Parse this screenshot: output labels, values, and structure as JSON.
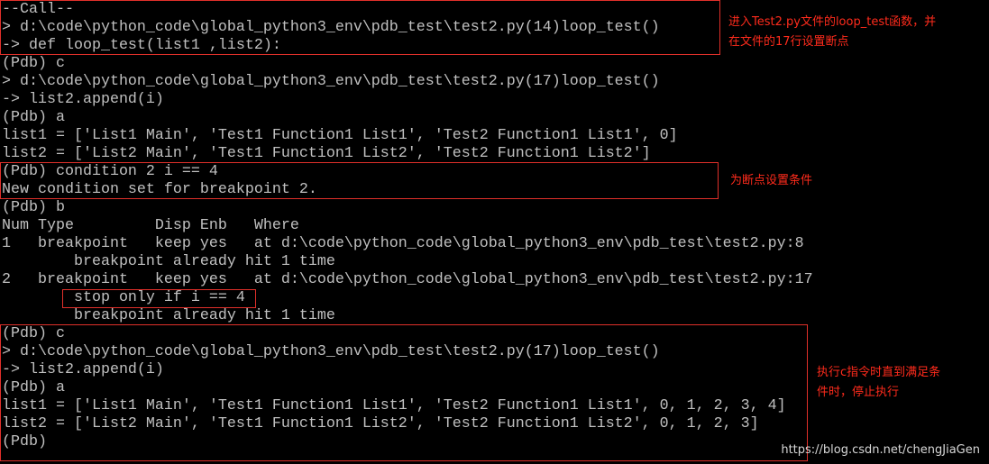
{
  "terminal": {
    "lines": [
      "--Call--",
      "> d:\\code\\python_code\\global_python3_env\\pdb_test\\test2.py(14)loop_test()",
      "-> def loop_test(list1 ,list2):",
      "(Pdb) c",
      "> d:\\code\\python_code\\global_python3_env\\pdb_test\\test2.py(17)loop_test()",
      "-> list2.append(i)",
      "(Pdb) a",
      "list1 = ['List1 Main', 'Test1 Function1 List1', 'Test2 Function1 List1', 0]",
      "list2 = ['List2 Main', 'Test1 Function1 List2', 'Test2 Function1 List2']",
      "(Pdb) condition 2 i == 4",
      "New condition set for breakpoint 2.",
      "(Pdb) b",
      "Num Type         Disp Enb   Where",
      "1   breakpoint   keep yes   at d:\\code\\python_code\\global_python3_env\\pdb_test\\test2.py:8",
      "        breakpoint already hit 1 time",
      "2   breakpoint   keep yes   at d:\\code\\python_code\\global_python3_env\\pdb_test\\test2.py:17",
      "        stop only if i == 4",
      "        breakpoint already hit 1 time",
      "(Pdb) c",
      "> d:\\code\\python_code\\global_python3_env\\pdb_test\\test2.py(17)loop_test()",
      "-> list2.append(i)",
      "(Pdb) a",
      "list1 = ['List1 Main', 'Test1 Function1 List1', 'Test2 Function1 List1', 0, 1, 2, 3, 4]",
      "list2 = ['List2 Main', 'Test1 Function1 List2', 'Test2 Function1 List2', 0, 1, 2, 3]",
      "(Pdb)"
    ]
  },
  "annotations": {
    "note1_line1": "进入Test2.py文件的loop_test函数，并",
    "note1_line2": "在文件的17行设置断点",
    "note2": "为断点设置条件",
    "note3_line1": "执行c指令时直到满足条",
    "note3_line2": "件时，停止执行"
  },
  "watermark": "https://blog.csdn.net/chengJiaGen",
  "colors": {
    "background": "#000000",
    "terminal_text": "#c0c0c0",
    "highlight": "#e0302a",
    "annotation_text": "#ff2b1c"
  }
}
